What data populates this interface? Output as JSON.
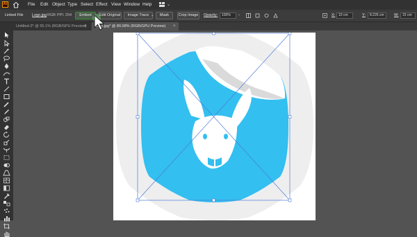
{
  "app": {
    "logo_text": "Ai"
  },
  "menu": [
    "File",
    "Edit",
    "Object",
    "Type",
    "Select",
    "Effect",
    "View",
    "Window",
    "Help"
  ],
  "control_bar": {
    "linked_file_label": "Linked File",
    "file_name": "Logo.jpg",
    "color_mode": "RGB",
    "ppi": "PPI: 254",
    "embed_button": "Embed",
    "edit_original_button": "Edit Original",
    "image_trace_button": "Image Trace",
    "mask_button": "Mask",
    "crop_button": "Crop Image",
    "opacity_label": "Opacity:",
    "opacity_value": "100%",
    "x_label": "X:",
    "x_value": "10 cm",
    "y_label": "Y:",
    "y_value": "8.226 cm",
    "w_label": "W:",
    "w_value": "15 cm"
  },
  "tabs": [
    {
      "label": "Untitled-3* @ 55.1% (RGB/GPU Preview)",
      "active": false
    },
    {
      "label": "Logo.jpg* @ 80.08% (RGB/GPU Preview)",
      "active": true
    }
  ],
  "tab_close_glyph": "×",
  "colors": {
    "accent_blue": "#33bff0",
    "hex_gray": "#eeeeef",
    "selection_blue": "#4a7bd6",
    "embed_highlight": "#3a8f3a",
    "cursor_green": "#66c466"
  },
  "icons": [
    "home-icon",
    "workspace-icon",
    "selection-tool-icon",
    "direct-selection-tool-icon",
    "magic-wand-icon",
    "lasso-icon",
    "pen-icon",
    "type-icon",
    "line-icon",
    "rectangle-icon",
    "paintbrush-icon",
    "pencil-icon",
    "eraser-icon",
    "rotate-icon",
    "scale-icon",
    "width-icon",
    "free-transform-icon",
    "shape-builder-icon",
    "perspective-icon",
    "mesh-icon",
    "gradient-icon",
    "eyedropper-icon",
    "blend-icon",
    "symbol-sprayer-icon",
    "graph-icon",
    "artboard-icon",
    "slice-icon",
    "hand-icon",
    "zoom-icon",
    "pointer-cursor-icon"
  ]
}
